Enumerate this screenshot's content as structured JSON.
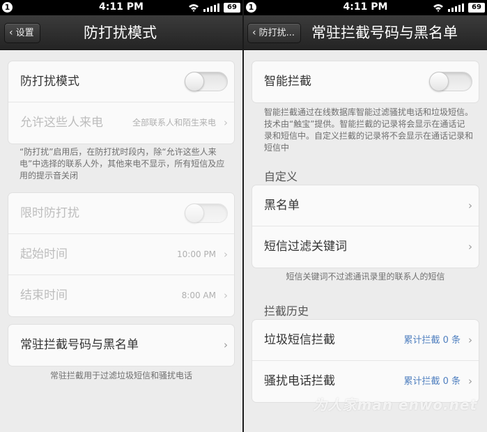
{
  "status": {
    "time": "4:11 PM",
    "notification_badge": "1",
    "battery": "69"
  },
  "left": {
    "back_label": "设置",
    "title": "防打扰模式",
    "dnd_label": "防打扰模式",
    "allow_label": "允许这些人来电",
    "allow_value": "全部联系人和陌生来电",
    "dnd_note": "“防打扰”启用后，在防打扰时段内，除“允许这些人来电”中选择的联系人外，其他来电不显示，所有短信及应用的提示音关闭",
    "timed_label": "限时防打扰",
    "start_label": "起始时间",
    "start_value": "10:00 PM",
    "end_label": "结束时间",
    "end_value": "8:00 AM",
    "block_label": "常驻拦截号码与黑名单",
    "block_note": "常驻拦截用于过滤垃圾短信和骚扰电话"
  },
  "right": {
    "back_label": "防打扰...",
    "title": "常驻拦截号码与黑名单",
    "smart_label": "智能拦截",
    "smart_note": "智能拦截通过在线数据库智能过滤骚扰电话和垃圾短信。技术由“触宝”提供。智能拦截的记录将会显示在通话记录和短信中。自定义拦截的记录将不会显示在通话记录和短信中",
    "custom_head": "自定义",
    "blacklist_label": "黑名单",
    "keyword_label": "短信过滤关键词",
    "keyword_note": "短信关键词不过滤通讯录里的联系人的短信",
    "history_head": "拦截历史",
    "spam_sms_label": "垃圾短信拦截",
    "spam_sms_value": "累计拦截 0 条",
    "spam_call_label": "骚扰电话拦截",
    "spam_call_value": "累计拦截 0 条"
  },
  "watermark": "为人家man enwo.net",
  "colors": {
    "accent_blue": "#4f7fbf",
    "titlebar": "#2e2e2e",
    "background": "#ececec"
  }
}
